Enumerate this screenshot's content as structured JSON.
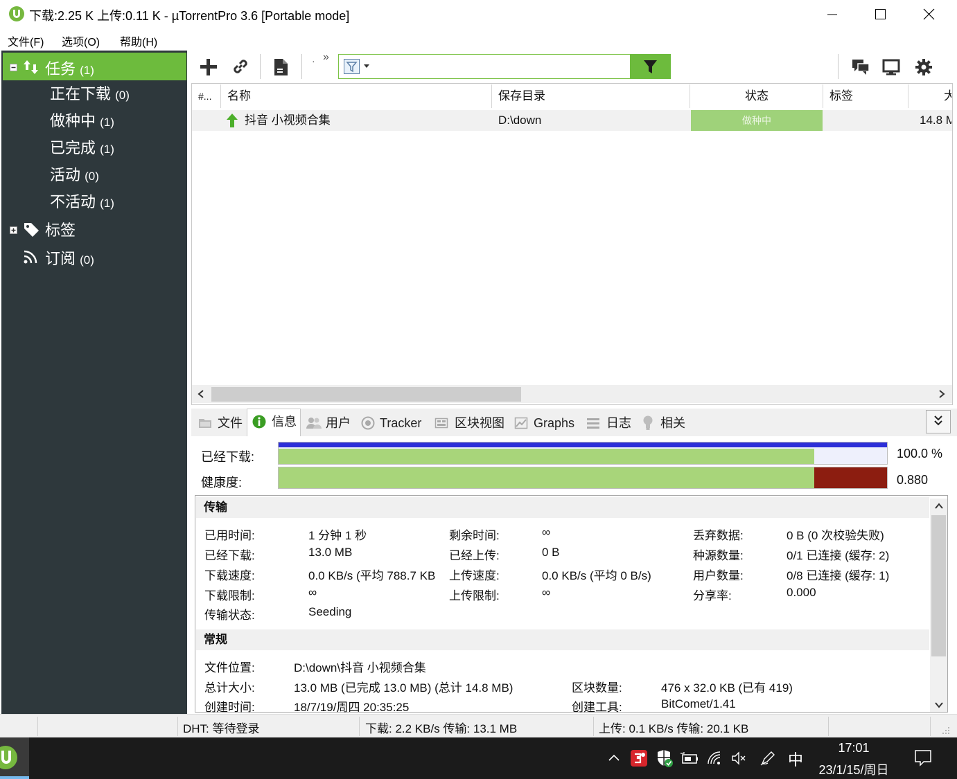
{
  "window": {
    "title": "下载:2.25 K 上传:0.11 K - µTorrentPro 3.6  [Portable mode]"
  },
  "menu": {
    "items": [
      "文件(F)",
      "选项(O)",
      "帮助(H)"
    ]
  },
  "sidebar": {
    "tasks": {
      "label": "任务",
      "count": "(1)"
    },
    "task_items": [
      {
        "label": "正在下载",
        "count": "(0)"
      },
      {
        "label": "做种中",
        "count": "(1)"
      },
      {
        "label": "已完成",
        "count": "(1)"
      },
      {
        "label": "活动",
        "count": "(0)"
      },
      {
        "label": "不活动",
        "count": "(1)"
      }
    ],
    "labels": {
      "label": "标签"
    },
    "feeds": {
      "label": "订阅",
      "count": "(0)"
    }
  },
  "toolbar": {
    "overflow": "»",
    "dot": "·",
    "search_value": ""
  },
  "list": {
    "columns": [
      "#...",
      "名称",
      "保存目录",
      "状态",
      "标签",
      "大"
    ],
    "rows": [
      {
        "name": "抖音 小视频合集",
        "save_dir": "D:\\down",
        "status": "做种中",
        "label": "",
        "size": "14.8 M"
      }
    ]
  },
  "tabs": [
    "文件",
    "信息",
    "用户",
    "Tracker",
    "区块视图",
    "Graphs",
    "日志",
    "相关"
  ],
  "active_tab": "信息",
  "progress": {
    "downloaded_label": "已经下载:",
    "downloaded_value": "100.0 %",
    "downloaded_fraction": 0.88,
    "availability_label": "健康度:",
    "availability_value": "0.880",
    "availability_fraction": 0.88
  },
  "details": {
    "transfer_header": "传输",
    "transfer": [
      [
        {
          "label": "已用时间:",
          "value": "1 分钟 1 秒"
        },
        {
          "label": "已经下载:",
          "value": "13.0 MB"
        },
        {
          "label": "下载速度:",
          "value": "0.0 KB/s (平均 788.7 KB"
        },
        {
          "label": "下载限制:",
          "value": "∞"
        },
        {
          "label": "传输状态:",
          "value": "Seeding"
        }
      ],
      [
        {
          "label": "剩余时间:",
          "value": "∞"
        },
        {
          "label": "已经上传:",
          "value": "0 B"
        },
        {
          "label": "上传速度:",
          "value": "0.0 KB/s (平均 0 B/s)"
        },
        {
          "label": "上传限制:",
          "value": "∞"
        }
      ],
      [
        {
          "label": "丢弃数据:",
          "value": "0 B (0 次校验失败)"
        },
        {
          "label": "种源数量:",
          "value": "0/1 已连接 (缓存: 2)"
        },
        {
          "label": "用户数量:",
          "value": "0/8 已连接 (缓存: 1)"
        },
        {
          "label": "分享率:",
          "value": "0.000"
        }
      ]
    ],
    "general_header": "常规",
    "general": [
      {
        "label": "文件位置:",
        "value": "D:\\down\\抖音 小视频合集"
      },
      {
        "label": "总计大小:",
        "value": "13.0 MB (已完成 13.0 MB) (总计 14.8 MB)"
      },
      {
        "label": "创建时间:",
        "value": "18/7/19/周四 20:35:25"
      }
    ],
    "general_right": [
      {
        "label": "区块数量:",
        "value": "476 x 32.0 KB (已有 419)"
      },
      {
        "label": "创建工具:",
        "value": "BitComet/1.41"
      }
    ]
  },
  "statusbar": {
    "dht": "DHT: 等待登录",
    "download": "下载: 2.2 KB/s 传输: 13.1 MB",
    "upload": "上传: 0.1 KB/s 传输: 20.1 KB"
  },
  "taskbar": {
    "time": "17:01",
    "date": "23/1/15/周日",
    "ime": "中"
  },
  "colors": {
    "accent_green": "#6dbb3d",
    "sidebar_bg": "#2e383c",
    "progress_green": "#a8d57a",
    "progress_blue": "#2d2fd8",
    "health_red": "#8c1d10"
  }
}
